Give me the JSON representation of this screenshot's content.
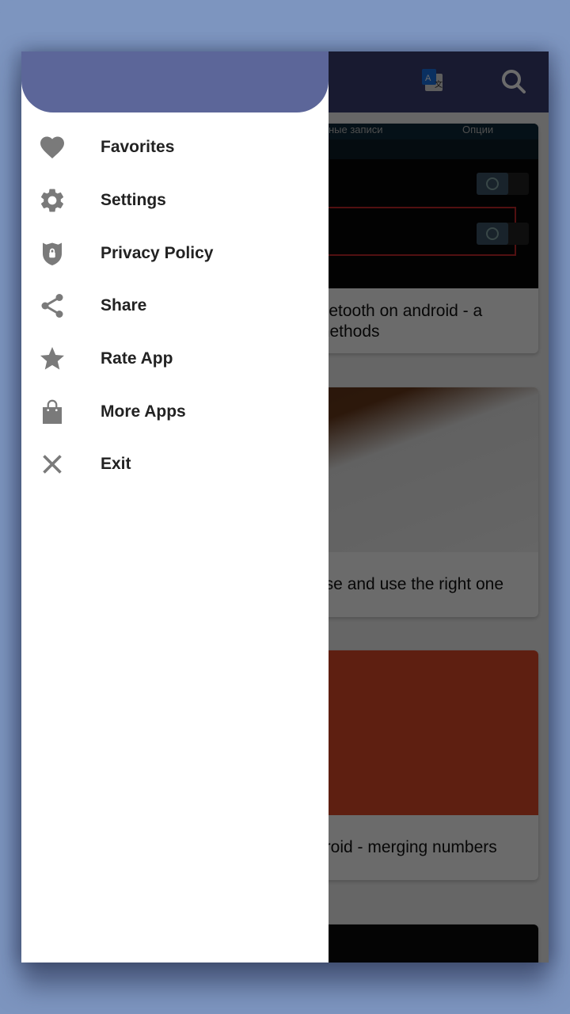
{
  "app_bar": {
    "translate_icon": "translate-icon",
    "search_icon": "search-icon"
  },
  "drawer": {
    "items": [
      {
        "label": "Favorites",
        "icon": "heart-icon"
      },
      {
        "label": "Settings",
        "icon": "gear-icon"
      },
      {
        "label": "Privacy Policy",
        "icon": "shield-lock-icon"
      },
      {
        "label": "Share",
        "icon": "share-icon"
      },
      {
        "label": "Rate App",
        "icon": "star-icon"
      },
      {
        "label": "More Apps",
        "icon": "shopping-bag-icon"
      },
      {
        "label": "Exit",
        "icon": "close-icon"
      }
    ]
  },
  "feed": {
    "cards": [
      {
        "title": "luetooth on android - a methods",
        "image_tabs": [
          "тные записи",
          "Опции"
        ]
      },
      {
        "title": "ose and use the right one"
      },
      {
        "title": "droid - merging numbers"
      },
      {
        "title": ""
      }
    ]
  },
  "colors": {
    "background": "#7d95bf",
    "app_bar": "#3a3f73",
    "drawer_header": "#5c6699",
    "icon_gray": "#7a7a7a"
  }
}
